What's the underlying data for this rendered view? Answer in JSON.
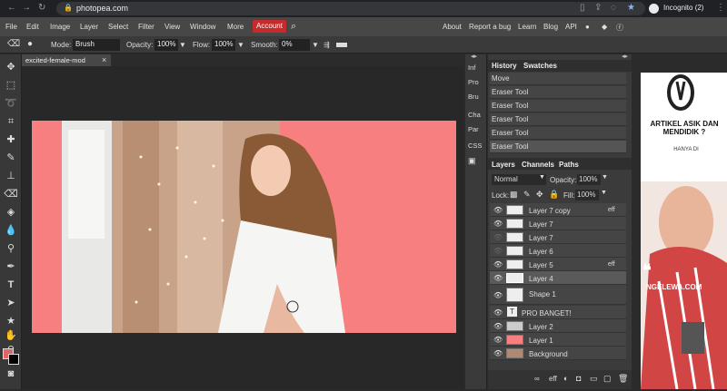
{
  "browser": {
    "url": "photopea.com",
    "profile": "Incognito (2)"
  },
  "menu": {
    "items": [
      "File",
      "Edit",
      "Image",
      "Layer",
      "Select",
      "Filter",
      "View",
      "Window",
      "More"
    ],
    "account": "Account",
    "right_items": [
      "About",
      "Report a bug",
      "Learn",
      "Blog",
      "API"
    ]
  },
  "options": {
    "mode_label": "Mode:",
    "mode_value": "Brush",
    "opacity_label": "Opacity:",
    "opacity_value": "100%",
    "flow_label": "Flow:",
    "flow_value": "100%",
    "smooth_label": "Smooth:",
    "smooth_value": "0%"
  },
  "document": {
    "tab_name": "excited-female-mod",
    "close": "×"
  },
  "strip": {
    "items": [
      "Inf",
      "Pro",
      "Bru",
      "Cha",
      "Par",
      "CSS"
    ]
  },
  "history": {
    "tab1": "History",
    "tab2": "Swatches",
    "items": [
      "Move",
      "Eraser Tool",
      "Eraser Tool",
      "Eraser Tool",
      "Eraser Tool",
      "Eraser Tool"
    ]
  },
  "layers_panel": {
    "tab1": "Layers",
    "tab2": "Channels",
    "tab3": "Paths",
    "blend": "Normal",
    "opacity_label": "Opacity:",
    "opacity_value": "100%",
    "lock_label": "Lock:",
    "fill_label": "Fill:",
    "fill_value": "100%",
    "layers": [
      "Layer 7 copy",
      "Layer 7",
      "Layer 7",
      "Layer 6",
      "Layer 5",
      "Layer 4",
      "Shape 1",
      "PRO BANGET!",
      "Layer 2",
      "Layer 1",
      "Background"
    ],
    "eff": "eff",
    "footer_eff": "eff"
  },
  "ad": {
    "headline": "ARTIKEL ASIK DAN MENDIDIK ?",
    "sub": "HANYA DI",
    "brand": "NGELEWA.COM"
  },
  "colors": {
    "accent": "#c62a2a",
    "canvas_bg": "#f87f7f",
    "fg_swatch": "#e06666"
  }
}
